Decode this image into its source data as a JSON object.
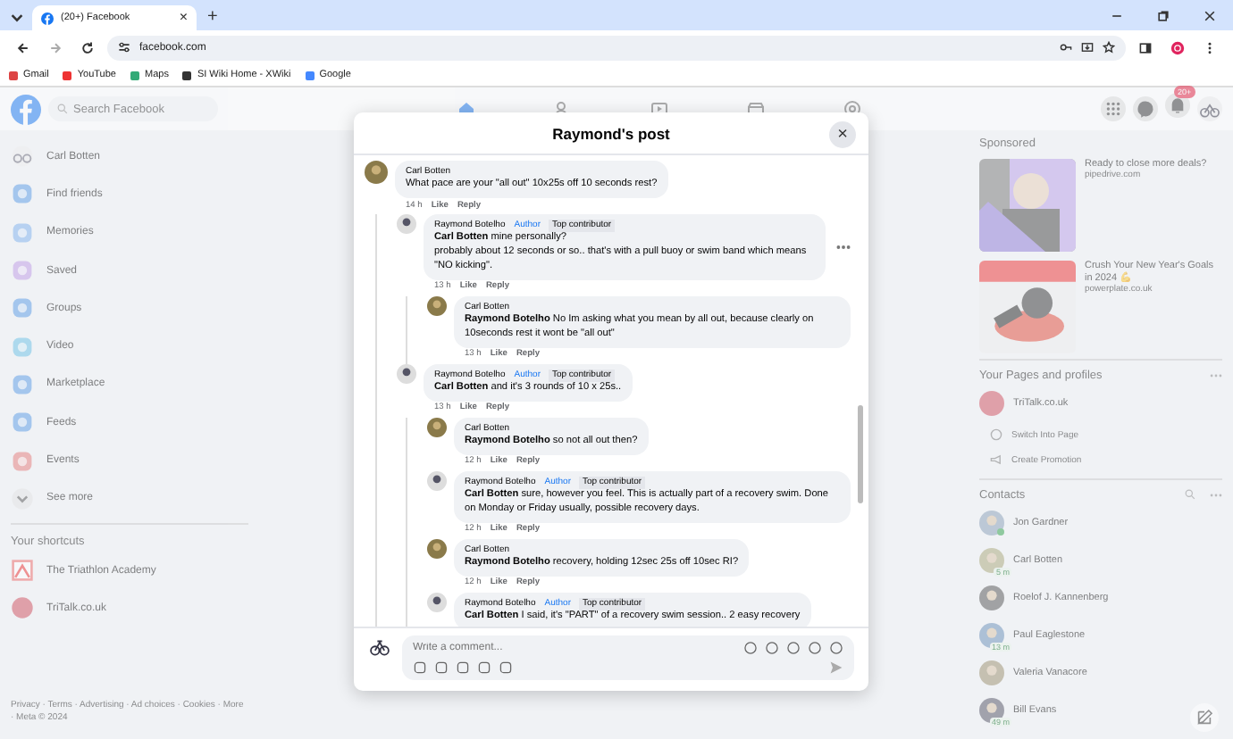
{
  "browser": {
    "tab_title": "(20+) Facebook",
    "tab_close": "×",
    "new_tab": "+",
    "url": "facebook.com",
    "bookmarks": [
      {
        "label": "Gmail"
      },
      {
        "label": "YouTube"
      },
      {
        "label": "Maps"
      },
      {
        "label": "SI Wiki Home - XWiki"
      },
      {
        "label": "Google"
      }
    ]
  },
  "header": {
    "search": {
      "placeholder": "Search Facebook"
    },
    "notification_badge": "20+"
  },
  "sidebar": {
    "items": [
      {
        "label": "Carl Botten"
      },
      {
        "label": "Find friends"
      },
      {
        "label": "Memories"
      },
      {
        "label": "Saved"
      },
      {
        "label": "Groups"
      },
      {
        "label": "Video"
      },
      {
        "label": "Marketplace"
      },
      {
        "label": "Feeds"
      },
      {
        "label": "Events"
      },
      {
        "label": "See more"
      }
    ],
    "shortcuts_title": "Your shortcuts",
    "shortcuts": [
      {
        "label": "The Triathlon Academy"
      },
      {
        "label": "TriTalk.co.uk"
      }
    ],
    "footer": "Privacy · Terms · Advertising · Ad choices · Cookies · More · Meta © 2024"
  },
  "right": {
    "sponsored_title": "Sponsored",
    "ads": [
      {
        "title": "Ready to close more deals?",
        "domain": "pipedrive.com"
      },
      {
        "title": "Crush Your New Year's Goals in 2024 💪",
        "domain": "powerplate.co.uk"
      }
    ],
    "pages_title": "Your Pages and profiles",
    "page": "TriTalk.co.uk",
    "page_actions": [
      "Switch Into Page",
      "Create Promotion"
    ],
    "contacts_title": "Contacts",
    "contacts": [
      {
        "name": "Jon Gardner",
        "online": true
      },
      {
        "name": "Carl Botten",
        "online": false,
        "away": "5 m"
      },
      {
        "name": "Roelof J. Kannenberg",
        "online": false
      },
      {
        "name": "Paul Eaglestone",
        "online": false,
        "away": "13 m"
      },
      {
        "name": "Valeria Vanacore",
        "online": false
      },
      {
        "name": "Bill Evans",
        "online": false,
        "away": "49 m"
      }
    ]
  },
  "modal": {
    "title": "Raymond's post",
    "close": "×",
    "comments": [
      {
        "author": "Carl Botten",
        "lines": [
          "What pace are your \"all out\" 10x25s off 10 seconds rest?"
        ],
        "time": "14 h",
        "like": "Like",
        "reply": "Reply",
        "children": [
          {
            "author": "Raymond Botelho",
            "badges": [
              {
                "label": "Author",
                "kind": "role"
              },
              {
                "label": "Top contributor",
                "kind": "tag"
              }
            ],
            "lines": [
              "**Carl Botten** mine personally?",
              "probably about 12 seconds or so.. that's with a pull buoy or swim band which means \"NO kicking\"."
            ],
            "time": "13 h",
            "like": "Like",
            "reply": "Reply",
            "hovered": true,
            "children": [
              {
                "author": "Carl Botten",
                "lines": [
                  "**Raymond Botelho** No Im asking what you mean by all out, because clearly on 10seconds rest it wont be \"all out\""
                ],
                "time": "13 h",
                "like": "Like",
                "reply": "Reply"
              }
            ]
          },
          {
            "author": "Raymond Botelho",
            "badges": [
              {
                "label": "Author",
                "kind": "role"
              },
              {
                "label": "Top contributor",
                "kind": "tag"
              }
            ],
            "lines": [
              "**Carl Botten** and it's 3 rounds of 10 x 25s.."
            ],
            "time": "13 h",
            "like": "Like",
            "reply": "Reply",
            "children": [
              {
                "author": "Carl Botten",
                "lines": [
                  "**Raymond Botelho** so not all out then?"
                ],
                "time": "12 h",
                "like": "Like",
                "reply": "Reply"
              },
              {
                "author": "Raymond Botelho",
                "badges": [
                  {
                    "label": "Author",
                    "kind": "role"
                  },
                  {
                    "label": "Top contributor",
                    "kind": "tag"
                  }
                ],
                "lines": [
                  "**Carl Botten** sure, however you feel. This is actually part of a recovery swim. Done on Monday or Friday usually, possible recovery days."
                ],
                "time": "12 h",
                "like": "Like",
                "reply": "Reply"
              },
              {
                "author": "Carl Botten",
                "lines": [
                  "**Raymond Botelho** recovery, holding 12sec 25s off 10sec RI?"
                ],
                "time": "12 h",
                "like": "Like",
                "reply": "Reply"
              },
              {
                "author": "Raymond Botelho",
                "badges": [
                  {
                    "label": "Author",
                    "kind": "role"
                  },
                  {
                    "label": "Top contributor",
                    "kind": "tag"
                  }
                ],
                "lines": [
                  "**Carl Botten** I said, it's \"PART\" of a recovery swim session.. 2 easy recovery"
                ]
              }
            ]
          }
        ]
      }
    ],
    "composer": {
      "placeholder": "Write a comment..."
    }
  }
}
